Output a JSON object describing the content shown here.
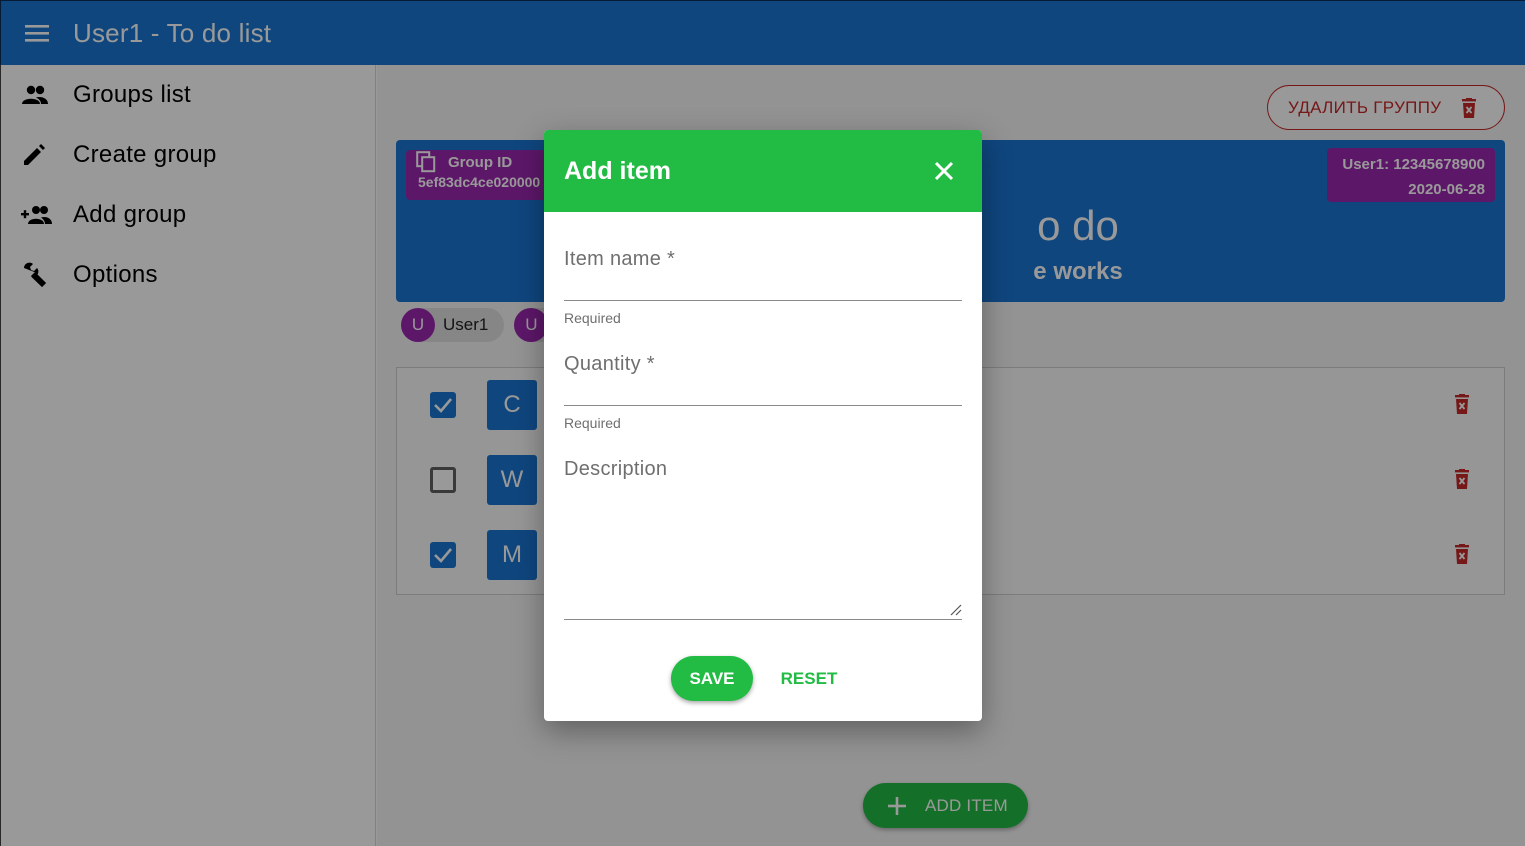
{
  "app": {
    "title": "User1 - To do list"
  },
  "sidebar": {
    "items": [
      {
        "label": "Groups list",
        "icon": "people-icon"
      },
      {
        "label": "Create group",
        "icon": "pencil-icon"
      },
      {
        "label": "Add group",
        "icon": "group-add-icon"
      },
      {
        "label": "Options",
        "icon": "wrench-icon"
      }
    ]
  },
  "main": {
    "delete_group_label": "УДАЛИТЬ ГРУППУ",
    "group": {
      "id_label": "Group ID",
      "id_value": "5ef83dc4ce020000",
      "owner": "User1: 12345678900",
      "date": "2020-06-28",
      "title_visible": "o do",
      "subtitle_visible": "e works"
    },
    "members": [
      {
        "initial": "U",
        "name": "User1"
      },
      {
        "initial": "U",
        "name": ""
      }
    ],
    "items": [
      {
        "initial": "C",
        "checked": true
      },
      {
        "initial": "W",
        "checked": false
      },
      {
        "initial": "M",
        "checked": true
      }
    ],
    "add_item_label": "ADD ITEM"
  },
  "dialog": {
    "title": "Add item",
    "fields": {
      "item_name": {
        "label": "Item name *",
        "hint": "Required",
        "value": ""
      },
      "quantity": {
        "label": "Quantity *",
        "hint": "Required",
        "value": ""
      },
      "description": {
        "label": "Description",
        "value": ""
      }
    },
    "save_label": "SAVE",
    "reset_label": "RESET"
  },
  "colors": {
    "primary": "#1976d2",
    "accent_green": "#22bb44",
    "chip_purple": "#9c27b0",
    "danger": "#c62828"
  }
}
